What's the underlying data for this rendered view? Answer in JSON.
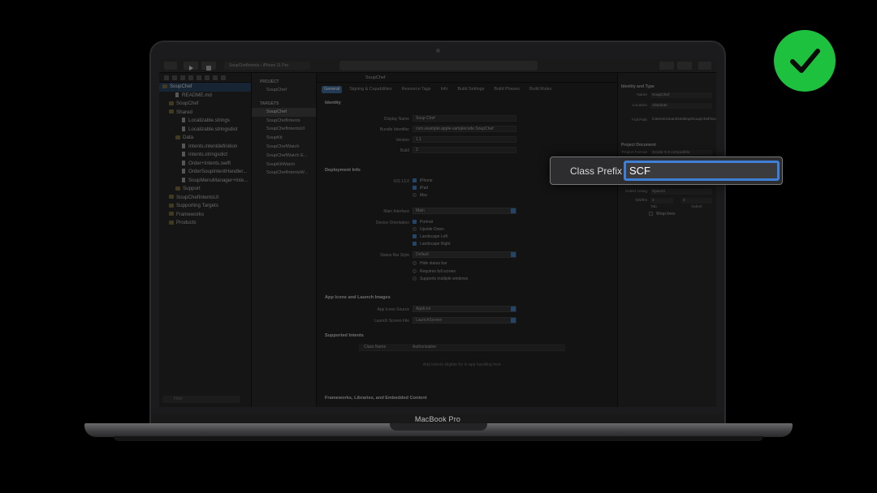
{
  "laptop": {
    "model_label": "MacBook Pro"
  },
  "toolbar": {
    "scheme": "SoupChefIntents",
    "device": "iPhone 11 Pro"
  },
  "navigator": {
    "items": [
      {
        "label": "SoupChef",
        "kind": "project",
        "depth": 0,
        "selected": true
      },
      {
        "label": "README.md",
        "kind": "file",
        "depth": 2
      },
      {
        "label": "SoupChef",
        "kind": "folder",
        "depth": 1
      },
      {
        "label": "Shared",
        "kind": "folder",
        "depth": 1
      },
      {
        "label": "Localizable.strings",
        "kind": "file",
        "depth": 3
      },
      {
        "label": "Localizable.stringsdict",
        "kind": "file",
        "depth": 3
      },
      {
        "label": "Data",
        "kind": "folder",
        "depth": 2
      },
      {
        "label": "Intents.intentdefinition",
        "kind": "file",
        "depth": 3
      },
      {
        "label": "Intents.stringsdict",
        "kind": "file",
        "depth": 3
      },
      {
        "label": "Order+Intents.swift",
        "kind": "file",
        "depth": 3
      },
      {
        "label": "OrderSoupIntentHandler...",
        "kind": "file",
        "depth": 3
      },
      {
        "label": "SoupMenuManager+Inte...",
        "kind": "file",
        "depth": 3
      },
      {
        "label": "Support",
        "kind": "folder",
        "depth": 2
      },
      {
        "label": "SoupChefIntentsUI",
        "kind": "folder",
        "depth": 1
      },
      {
        "label": "Supporting Targets",
        "kind": "folder",
        "depth": 1
      },
      {
        "label": "Frameworks",
        "kind": "folder",
        "depth": 1
      },
      {
        "label": "Products",
        "kind": "folder",
        "depth": 1
      }
    ],
    "filter_placeholder": "Filter"
  },
  "project_list": {
    "project_header": "PROJECT",
    "project": "SoupChef",
    "targets_header": "TARGETS",
    "targets": [
      "SoupChef",
      "SoupChefIntents",
      "SoupChefIntentsUI",
      "SoupKit",
      "SoupChefWatch",
      "SoupChefWatch E...",
      "SoupKitWatch",
      "SoupChefIntentsW..."
    ],
    "selected_target": "SoupChef"
  },
  "editor": {
    "breadcrumb": "SoupChef",
    "tabs": [
      "General",
      "Signing & Capabilities",
      "Resource Tags",
      "Info",
      "Build Settings",
      "Build Phases",
      "Build Rules"
    ],
    "active_tab": "General",
    "identity": {
      "title": "Identity",
      "display_name_label": "Display Name",
      "display_name": "Soup Chef",
      "bundle_label": "Bundle Identifier",
      "bundle_id": "com.example.apple-samplecode.SoupChef",
      "version_label": "Version",
      "version": "1.1",
      "build_label": "Build",
      "build": "2"
    },
    "deployment": {
      "title": "Deployment Info",
      "ios_label": "iOS 13.0",
      "devices": [
        {
          "label": "iPhone",
          "checked": true
        },
        {
          "label": "iPad",
          "checked": true
        },
        {
          "label": "Mac",
          "checked": false
        }
      ],
      "main_interface_label": "Main Interface",
      "main_interface": "Main",
      "orientation_label": "Device Orientation",
      "orientations": [
        {
          "label": "Portrait",
          "checked": true
        },
        {
          "label": "Upside Down",
          "checked": false
        },
        {
          "label": "Landscape Left",
          "checked": true
        },
        {
          "label": "Landscape Right",
          "checked": true
        }
      ],
      "status_bar_label": "Status Bar Style",
      "status_bar": "Default",
      "status_options": [
        {
          "label": "Hide status bar",
          "checked": false
        },
        {
          "label": "Requires full screen",
          "checked": false
        },
        {
          "label": "Supports multiple windows",
          "checked": false
        }
      ]
    },
    "app_icons": {
      "title": "App Icons and Launch Images",
      "source_label": "App Icons Source",
      "source": "AppIcon",
      "launch_label": "Launch Screen File",
      "launch": "LaunchScreen"
    },
    "supported_intents": {
      "title": "Supported Intents",
      "col_class": "Class Name",
      "col_auth": "Authorization",
      "empty": "Add intents eligible for in-app handling here"
    },
    "frameworks": {
      "title": "Frameworks, Libraries, and Embedded Content"
    }
  },
  "inspector": {
    "identity_title": "Identity and Type",
    "name_label": "Name",
    "name": "SoupChef",
    "location_label": "Location",
    "location": "Absolute",
    "full_path_label": "Full Path",
    "full_path": "/Users/roman/Desktop/SoupChef/SoupChef.xcodeproj",
    "project_doc_title": "Project Document",
    "format_label": "Project Format",
    "format": "Xcode 9.3-compatible",
    "indent_label": "Indent Using",
    "indent": "Spaces",
    "widths_label": "Widths",
    "tab_width": "4",
    "indent_width": "4",
    "tab_caption": "Tab",
    "indent_caption": "Indent",
    "wrap_label": "Wrap lines"
  },
  "callout": {
    "label": "Class Prefix",
    "value": "SCF",
    "accent": "#3f7fd6"
  },
  "badge": {
    "icon": "checkmark-icon",
    "color": "#1ec13d"
  }
}
